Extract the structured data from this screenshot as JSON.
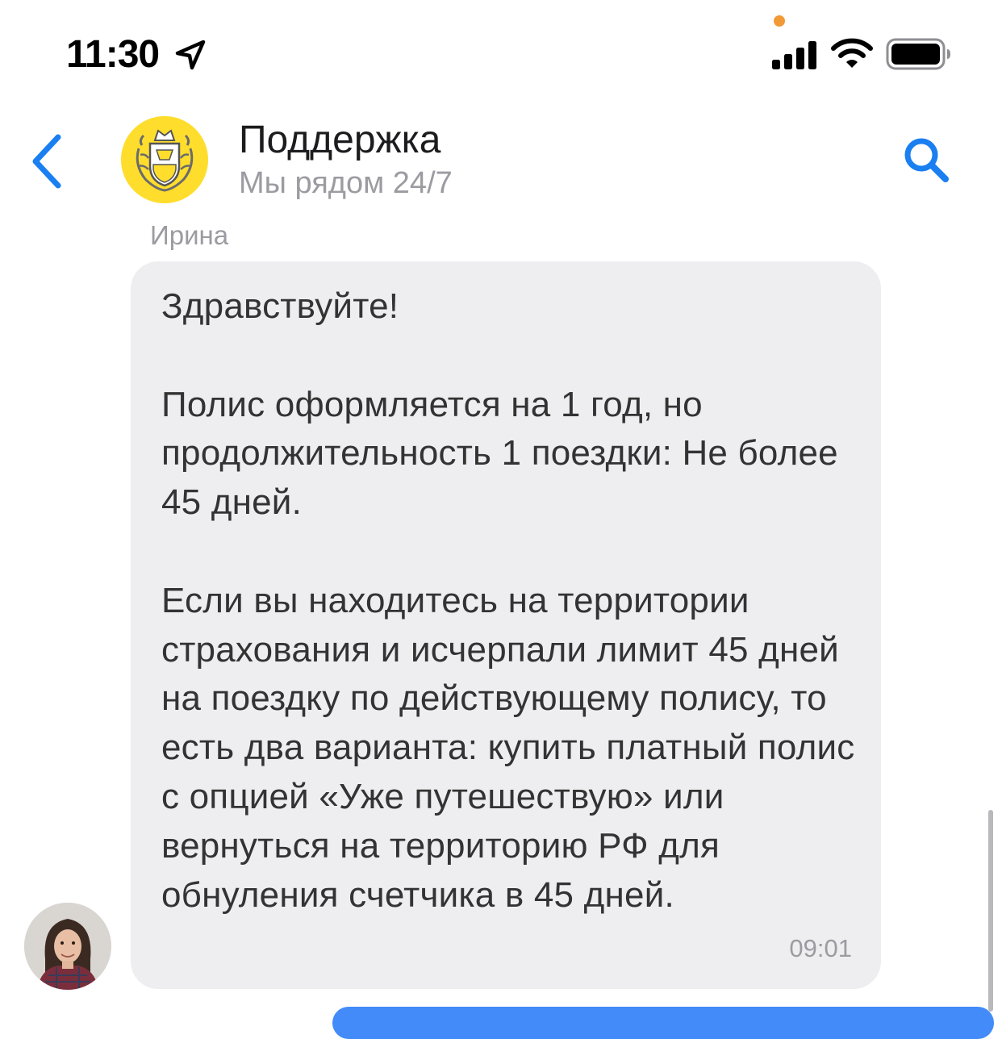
{
  "status_bar": {
    "time": "11:30",
    "location_icon": "location-arrow-icon",
    "signal_icon": "cellular-signal-icon",
    "wifi_icon": "wifi-icon",
    "battery_icon": "battery-icon",
    "privacy_dot_color": "#f19a37"
  },
  "header": {
    "back_icon": "chevron-left-icon",
    "title": "Поддержка",
    "subtitle": "Мы рядом 24/7",
    "search_icon": "search-icon",
    "accent_color": "#1a7ff0",
    "logo_color": "#ffdd2d"
  },
  "messages": [
    {
      "sender": "Ирина",
      "text": "Здравствуйте!\n\nПолис оформляется на 1 год, но продолжительность 1 поездки: Не более 45 дней.\n\nЕсли вы находитесь на территории страхования и исчерпали лимит 45 дней на поездку по действующему полису, то есть два варианта: купить платный полис с опцией «Уже путешествую» или вернуться на территорию РФ для обнуления счетчика в 45 дней.",
      "time": "09:01",
      "bubble_color": "#eeeef1"
    }
  ]
}
